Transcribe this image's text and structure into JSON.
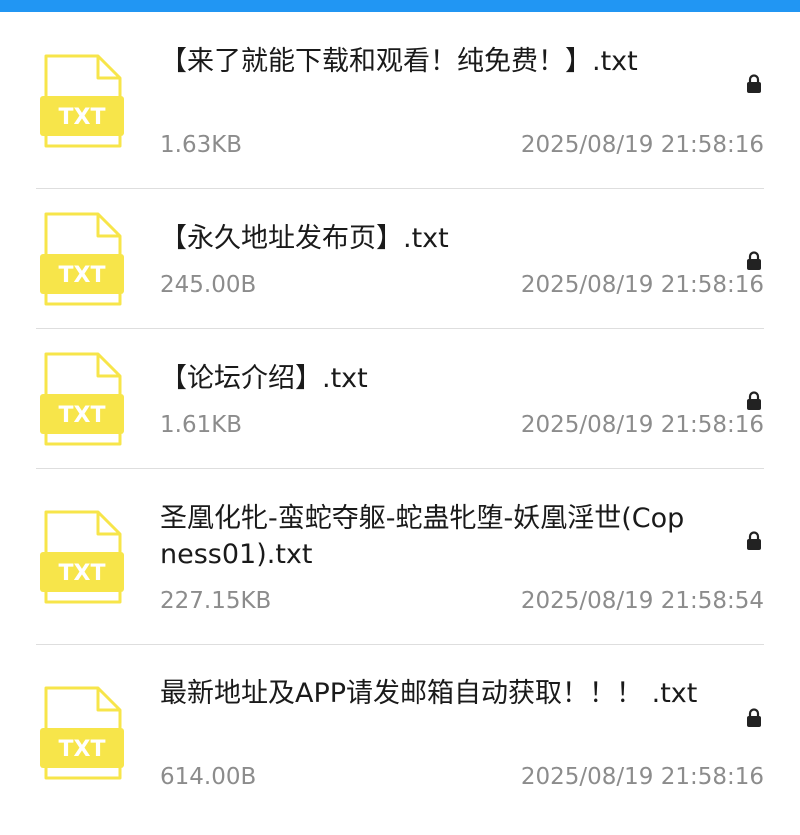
{
  "header": {
    "color": "#2196f3"
  },
  "icon": {
    "name": "txt-file-icon",
    "label": "TXT",
    "color": "#f7e54a"
  },
  "files": [
    {
      "name": "【来了就能下载和观看！纯免费！】.txt",
      "size": "1.63KB",
      "date": "2025/08/19 21:58:16",
      "locked": true
    },
    {
      "name": "【永久地址发布页】.txt",
      "size": "245.00B",
      "date": "2025/08/19 21:58:16",
      "locked": true
    },
    {
      "name": "【论坛介绍】.txt",
      "size": "1.61KB",
      "date": "2025/08/19 21:58:16",
      "locked": true
    },
    {
      "name": "圣凰化牝-蛮蛇夺躯-蛇蛊牝堕-妖凰淫世(Copness01).txt",
      "size": "227.15KB",
      "date": "2025/08/19 21:58:54",
      "locked": true
    },
    {
      "name": "最新地址及APP请发邮箱自动获取！！！ .txt",
      "size": "614.00B",
      "date": "2025/08/19 21:58:16",
      "locked": true
    }
  ]
}
